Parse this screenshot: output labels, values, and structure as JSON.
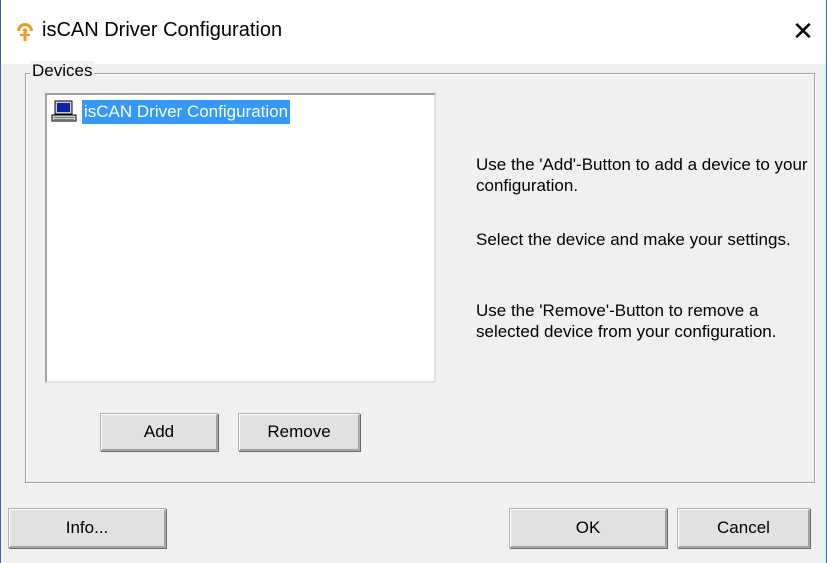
{
  "window": {
    "title": "isCAN Driver Configuration",
    "close_glyph": "✕",
    "icon": "app-logo-icon"
  },
  "devices_group": {
    "legend": "Devices",
    "items": [
      {
        "label": "isCAN Driver Configuration",
        "icon": "computer-icon",
        "selected": true
      }
    ],
    "add_label": "Add",
    "remove_label": "Remove"
  },
  "help": {
    "para1": "Use the 'Add'-Button to add a device to your configuration.",
    "para2": "Select the device and make your settings.",
    "para3": "Use the 'Remove'-Button to remove a selected device from your configuration."
  },
  "footer": {
    "info_label": "Info...",
    "ok_label": "OK",
    "cancel_label": "Cancel"
  },
  "colors": {
    "selection": "#3399ff",
    "dialog_bg": "#f0f0f0",
    "frame": "#2b6cb5",
    "icon_orange": "#f39a1d"
  }
}
